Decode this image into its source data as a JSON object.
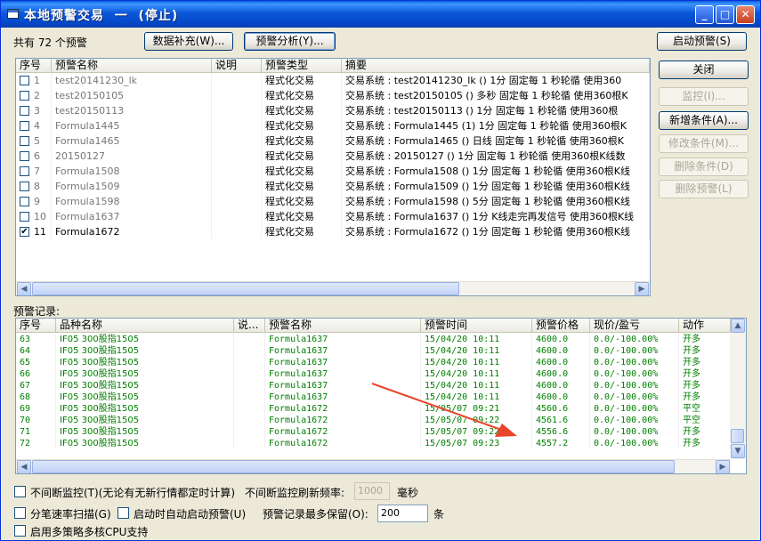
{
  "window": {
    "title": "本地预警交易  一  (停止)"
  },
  "titlebar_buttons": {
    "minimize": "_",
    "maximize": "□",
    "close": "✕"
  },
  "header": {
    "count_text": "共有 72 个预警",
    "data_fill_button": "数据补充(W)...",
    "analysis_button": "预警分析(Y)...",
    "start_button": "启动预警(S)"
  },
  "alert_table": {
    "columns": [
      "序号",
      "预警名称",
      "说明",
      "预警类型",
      "摘要"
    ],
    "rows": [
      {
        "checked": false,
        "no": "1",
        "name": "test20141230_lk",
        "desc": "",
        "type": "程式化交易",
        "summary": "交易系统 : test20141230_lk () 1分 固定每 1 秒轮循 使用360"
      },
      {
        "checked": false,
        "no": "2",
        "name": "test20150105",
        "desc": "",
        "type": "程式化交易",
        "summary": "交易系统 : test20150105 () 多秒 固定每 1 秒轮循 使用360根K"
      },
      {
        "checked": false,
        "no": "3",
        "name": "test20150113",
        "desc": "",
        "type": "程式化交易",
        "summary": "交易系统 : test20150113 () 1分 固定每 1 秒轮循 使用360根"
      },
      {
        "checked": false,
        "no": "4",
        "name": "Formula1445",
        "desc": "",
        "type": "程式化交易",
        "summary": "交易系统 : Formula1445 (1) 1分 固定每 1 秒轮循 使用360根K"
      },
      {
        "checked": false,
        "no": "5",
        "name": "Formula1465",
        "desc": "",
        "type": "程式化交易",
        "summary": "交易系统 : Formula1465 () 日线 固定每 1 秒轮循 使用360根K"
      },
      {
        "checked": false,
        "no": "6",
        "name": "20150127",
        "desc": "",
        "type": "程式化交易",
        "summary": "交易系统 : 20150127 () 1分 固定每 1 秒轮循 使用360根K线数"
      },
      {
        "checked": false,
        "no": "7",
        "name": "Formula1508",
        "desc": "",
        "type": "程式化交易",
        "summary": "交易系统 : Formula1508 () 1分 固定每 1 秒轮循 使用360根K线"
      },
      {
        "checked": false,
        "no": "8",
        "name": "Formula1509",
        "desc": "",
        "type": "程式化交易",
        "summary": "交易系统 : Formula1509 () 1分 固定每 1 秒轮循 使用360根K线"
      },
      {
        "checked": false,
        "no": "9",
        "name": "Formula1598",
        "desc": "",
        "type": "程式化交易",
        "summary": "交易系统 : Formula1598 () 5分 固定每 1 秒轮循 使用360根K线"
      },
      {
        "checked": false,
        "no": "10",
        "name": "Formula1637",
        "desc": "",
        "type": "程式化交易",
        "summary": "交易系统 : Formula1637 () 1分 K线走完再发信号 使用360根K线"
      },
      {
        "checked": true,
        "no": "11",
        "name": "Formula1672",
        "desc": "",
        "type": "程式化交易",
        "summary": "交易系统 : Formula1672 () 1分 固定每 1 秒轮循 使用360根K线"
      }
    ]
  },
  "side_buttons": {
    "close": "关闭",
    "monitor": "监控(I)...",
    "add_condition": "新增条件(A)...",
    "edit_condition": "修改条件(M)...",
    "delete_condition": "删除条件(D)",
    "delete_alert": "删除预警(L)"
  },
  "records": {
    "section_label": "预警记录:",
    "columns": [
      "序号",
      "品种名称",
      "说...",
      "预警名称",
      "预警时间",
      "预警价格",
      "现价/盈亏",
      "动作"
    ],
    "rows": [
      {
        "no": "63",
        "symbol": "IF05 300股指1505",
        "note": "",
        "alert": "Formula1637",
        "time": "15/04/20 10:11",
        "price": "4600.0",
        "pnl": "0.0/-100.00%",
        "action": "开多"
      },
      {
        "no": "64",
        "symbol": "IF05 300股指1505",
        "note": "",
        "alert": "Formula1637",
        "time": "15/04/20 10:11",
        "price": "4600.0",
        "pnl": "0.0/-100.00%",
        "action": "开多"
      },
      {
        "no": "65",
        "symbol": "IF05 300股指1505",
        "note": "",
        "alert": "Formula1637",
        "time": "15/04/20 10:11",
        "price": "4600.0",
        "pnl": "0.0/-100.00%",
        "action": "开多"
      },
      {
        "no": "66",
        "symbol": "IF05 300股指1505",
        "note": "",
        "alert": "Formula1637",
        "time": "15/04/20 10:11",
        "price": "4600.0",
        "pnl": "0.0/-100.00%",
        "action": "开多"
      },
      {
        "no": "67",
        "symbol": "IF05 300股指1505",
        "note": "",
        "alert": "Formula1637",
        "time": "15/04/20 10:11",
        "price": "4600.0",
        "pnl": "0.0/-100.00%",
        "action": "开多"
      },
      {
        "no": "68",
        "symbol": "IF05 300股指1505",
        "note": "",
        "alert": "Formula1637",
        "time": "15/04/20 10:11",
        "price": "4600.0",
        "pnl": "0.0/-100.00%",
        "action": "开多"
      },
      {
        "no": "69",
        "symbol": "IF05 300股指1505",
        "note": "",
        "alert": "Formula1672",
        "time": "15/05/07 09:21",
        "price": "4560.6",
        "pnl": "0.0/-100.00%",
        "action": "平空"
      },
      {
        "no": "70",
        "symbol": "IF05 300股指1505",
        "note": "",
        "alert": "Formula1672",
        "time": "15/05/07 09:22",
        "price": "4561.6",
        "pnl": "0.0/-100.00%",
        "action": "平空"
      },
      {
        "no": "71",
        "symbol": "IF05 300股指1505",
        "note": "",
        "alert": "Formula1672",
        "time": "15/05/07 09:22",
        "price": "4556.6",
        "pnl": "0.0/-100.00%",
        "action": "开多"
      },
      {
        "no": "72",
        "symbol": "IF05 300股指1505",
        "note": "",
        "alert": "Formula1672",
        "time": "15/05/07 09:23",
        "price": "4557.2",
        "pnl": "0.0/-100.00%",
        "action": "开多"
      }
    ]
  },
  "options": {
    "continuous_monitor": "不间断监控(T)(无论有无新行情都定时计算)",
    "refresh_label": "不间断监控刷新频率:",
    "refresh_value": "1000",
    "refresh_unit": "毫秒",
    "batch_scan": "分笔速率扫描(G)",
    "auto_start": "启动时自动启动预警(U)",
    "keep_label": "预警记录最多保留(O):",
    "keep_value": "200",
    "keep_unit": "条",
    "multi_cpu": "启用多策略多核CPU支持"
  },
  "colors": {
    "record_text": "#008000",
    "annotation_arrow": "#e8452c",
    "title_bar": "#0a5fe0"
  }
}
